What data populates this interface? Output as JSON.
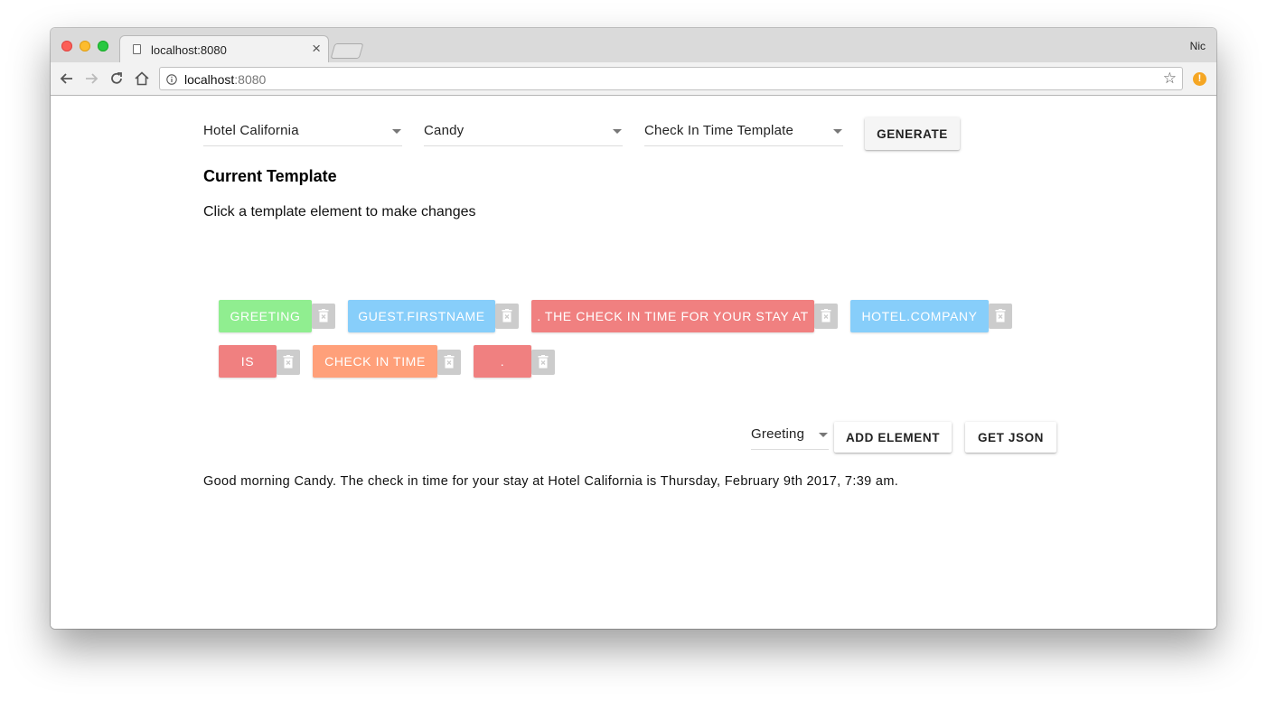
{
  "browser": {
    "tab_title": "localhost:8080",
    "tab_close": "×",
    "profile_name": "Nic",
    "url_host": "localhost",
    "url_port": ":8080",
    "extension_badge": "!"
  },
  "controls": {
    "hotel_value": "Hotel California",
    "guest_value": "Candy",
    "template_value": "Check In Time Template",
    "generate_label": "GENERATE"
  },
  "template": {
    "heading": "Current Template",
    "instruction": "Click a template element to make changes",
    "elements": [
      {
        "label": "GREETING",
        "color": "#90ee90"
      },
      {
        "label": "GUEST.FIRSTNAME",
        "color": "#87cefa"
      },
      {
        "label": ". THE CHECK IN TIME FOR YOUR STAY AT",
        "color": "#f08080"
      },
      {
        "label": "HOTEL.COMPANY",
        "color": "#87cefa"
      },
      {
        "label": "IS",
        "color": "#f08080"
      },
      {
        "label": "CHECK IN TIME",
        "color": "#ffa07a"
      },
      {
        "label": ".",
        "color": "#f08080"
      }
    ]
  },
  "actions": {
    "element_type_value": "Greeting",
    "add_element_label": "ADD ELEMENT",
    "get_json_label": "GET JSON"
  },
  "output_message": "Good morning Candy. The check in time for your stay at Hotel California is Thursday, February 9th 2017, 7:39 am."
}
